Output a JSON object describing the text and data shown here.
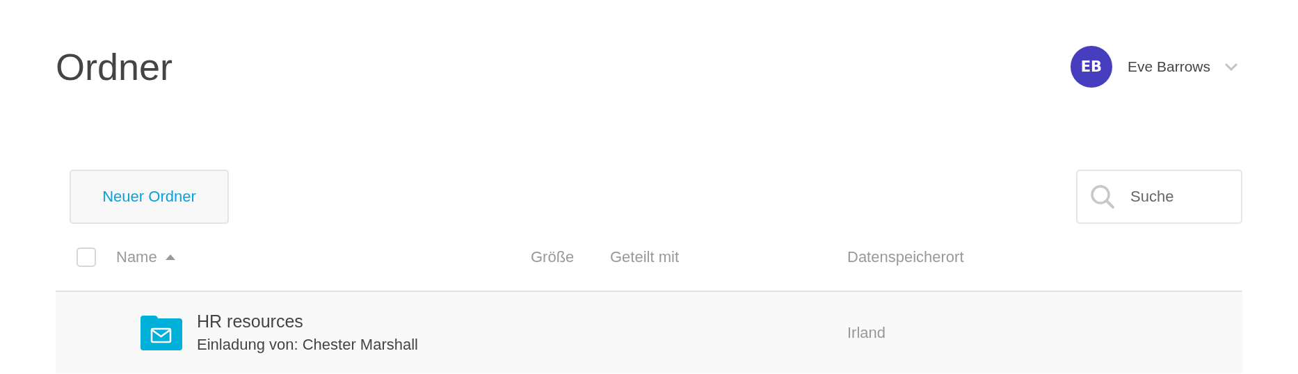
{
  "page": {
    "title": "Ordner"
  },
  "user": {
    "initials": "EB",
    "name": "Eve Barrows"
  },
  "toolbar": {
    "new_folder_button": "Neuer Ordner",
    "search": {
      "placeholder": "Suche"
    }
  },
  "table": {
    "select_all": {
      "checked": false
    },
    "columns": [
      {
        "label": "Name",
        "sorted": true
      },
      {
        "label": "Größe",
        "sorted": false
      },
      {
        "label": "Geteilt mit",
        "sorted": false
      },
      {
        "label": "Datenspeicherort",
        "sorted": false
      }
    ],
    "rows": [
      {
        "kind": "invitation",
        "name": "HR resources",
        "subtitle": "Einladung von: Chester Marshall",
        "size": "",
        "shared_with": "",
        "location": "Irland"
      }
    ]
  }
}
